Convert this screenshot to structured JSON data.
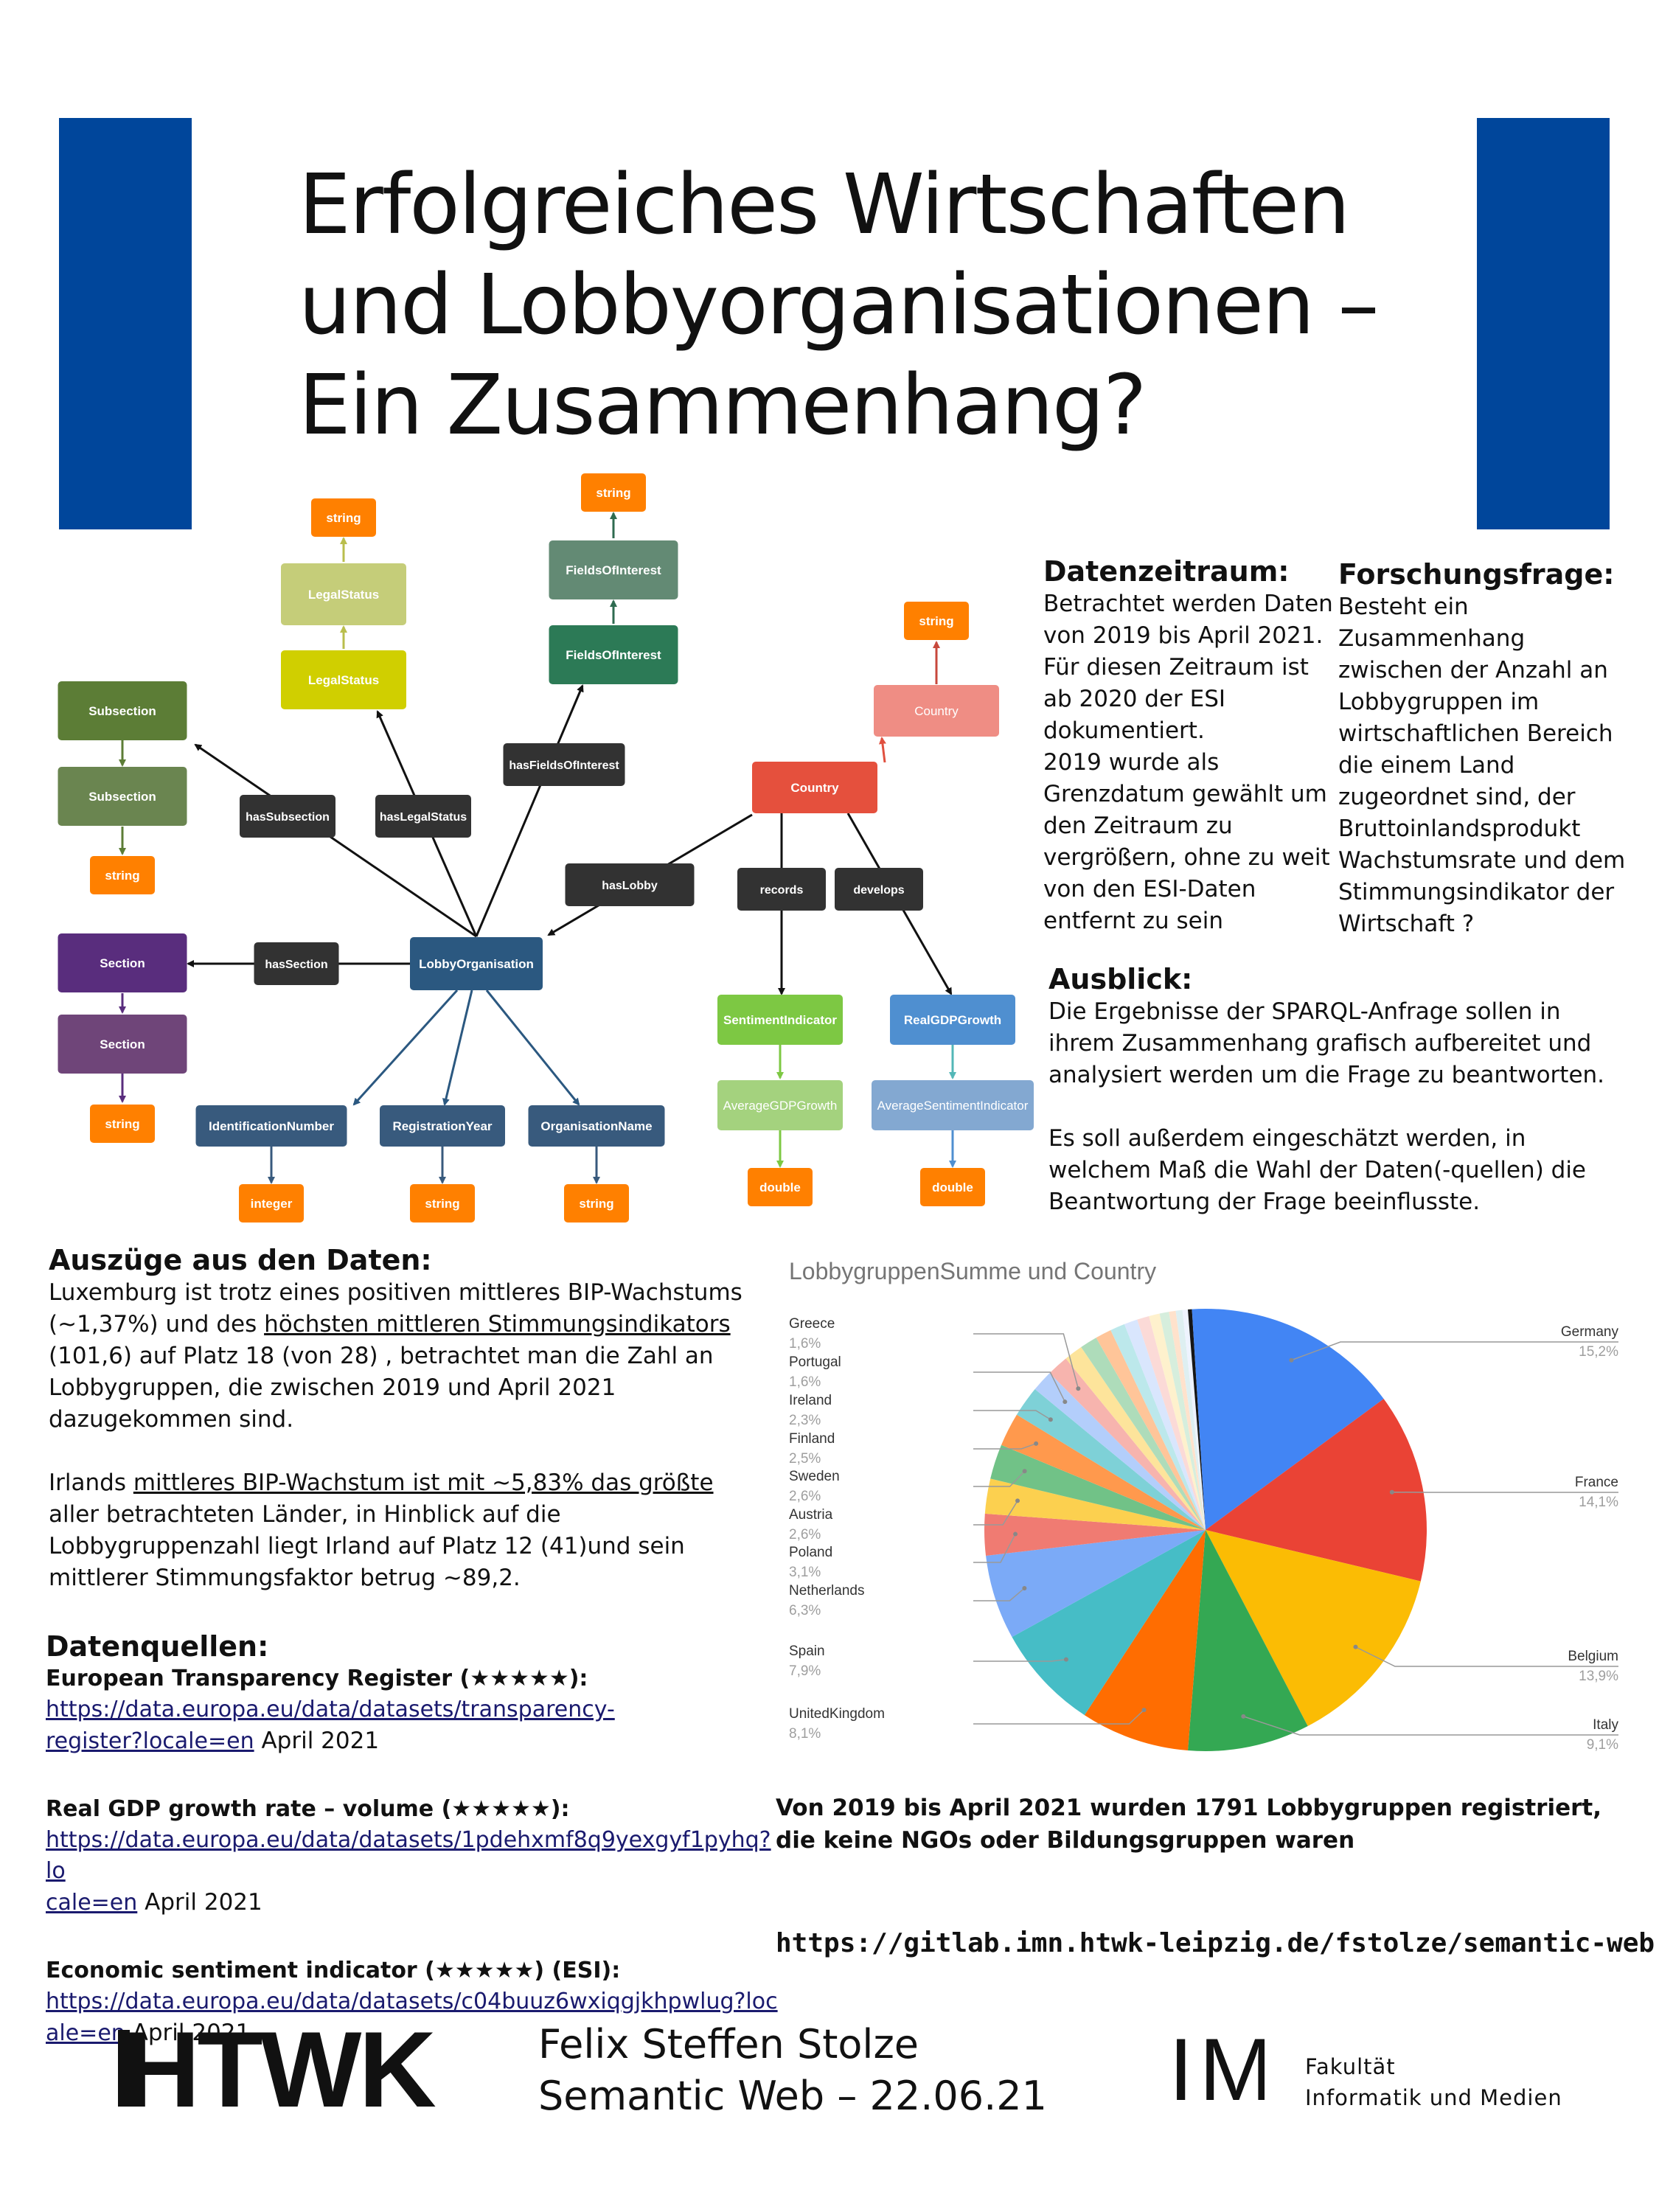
{
  "title": [
    "Erfolgreiches Wirtschaften",
    "und Lobbyorganisationen –",
    "Ein Zusammenhang?"
  ],
  "colors": {
    "hs_blue": "#00469b"
  },
  "diagram": {
    "nodes": {
      "string_legal": "string",
      "legal2": "LegalStatus",
      "legal1": "LegalStatus",
      "string_fields": "string",
      "fields2": "FieldsOfInterest",
      "fields1": "FieldsOfInterest",
      "string_country": "string",
      "country2": "Country",
      "country1": "Country",
      "subsection1": "Subsection",
      "subsection2": "Subsection",
      "string_sub": "string",
      "section1": "Section",
      "section2": "Section",
      "string_sec": "string",
      "lobby": "LobbyOrganisation",
      "idnum": "IdentificationNumber",
      "regyear": "RegistrationYear",
      "orgname": "OrganisationName",
      "integer": "integer",
      "string_reg": "string",
      "string_org": "string",
      "sentiment": "SentimentIndicator",
      "realgdp": "RealGDPGrowth",
      "avggdp": "AverageGDPGrowth",
      "avgsent": "AverageSentimentIndicator",
      "double1": "double",
      "double2": "double"
    },
    "edges": {
      "hasSubsection": "hasSubsection",
      "hasLegalStatus": "hasLegalStatus",
      "hasFieldsOfInterest": "hasFieldsOfInterest",
      "hasLobby": "hasLobby",
      "records": "records",
      "develops": "develops",
      "hasSection": "hasSection"
    }
  },
  "datenzeitraum": {
    "heading": "Datenzeitraum:",
    "lines": [
      "Betrachtet werden Daten",
      "von 2019 bis April 2021.",
      "Für diesen Zeitraum ist",
      "ab 2020 der ESI",
      "dokumentiert.",
      "2019 wurde als",
      "Grenzdatum gewählt um",
      "den Zeitraum zu",
      "vergrößern, ohne zu weit",
      "von den ESI-Daten",
      "entfernt zu sein"
    ]
  },
  "forschungsfrage": {
    "heading": "Forschungsfrage:",
    "lines": [
      "Besteht ein",
      "Zusammenhang",
      "zwischen der Anzahl an",
      "Lobbygruppen im",
      "wirtschaftlichen Bereich",
      "die einem Land",
      "zugeordnet sind, der",
      "Bruttoinlandsprodukt",
      "Wachstumsrate und dem",
      "Stimmungsindikator der",
      "Wirtschaft ?"
    ]
  },
  "ausblick": {
    "heading": "Ausblick:",
    "lines1": [
      "Die Ergebnisse der SPARQL-Anfrage sollen in",
      "ihrem Zusammenhang grafisch aufbereitet und",
      "analysiert werden um die Frage zu beantworten."
    ],
    "lines2": [
      "Es soll außerdem eingeschätzt werden, in",
      "welchem Maß die Wahl der Daten(-quellen) die",
      "Beantwortung der Frage beeinflusste."
    ]
  },
  "auszuege": {
    "heading": "Auszüge aus den Daten:",
    "p1": {
      "l1": "Luxemburg ist trotz eines positiven mittleres BIP-Wachstums",
      "l2a": "(~1,37%) und des ",
      "l2u": "höchsten mittleren Stimmungsindikators",
      "l3": "(101,6) auf Platz 18 (von 28) , betrachtet man die Zahl an",
      "l4": "Lobbygruppen, die zwischen 2019 und April 2021",
      "l5": "dazugekommen sind."
    },
    "p2": {
      "l1a": "Irlands ",
      "l1u": "mittleres BIP-Wachstum ist mit ~5,83% das größte",
      "l2": "aller betrachteten Länder, in Hinblick auf die",
      "l3": "Lobbygruppenzahl liegt Irland auf Platz 12 (41)und sein",
      "l4": "mittlerer Stimmungsfaktor betrug ~89,2."
    }
  },
  "datenquellen": {
    "heading": "Datenquellen:",
    "sources": [
      {
        "name": "European Transparency Register (★★★★★):",
        "link1": "https://data.europa.eu/data/datasets/transparency-",
        "link2": "register?locale=en",
        "date": " April 2021"
      },
      {
        "name": "Real GDP growth rate – volume (★★★★★):",
        "link1": "https://data.europa.eu/data/datasets/1pdehxmf8q9yexgyf1pyhq?lo",
        "link2": "cale=en",
        "date": " April 2021"
      },
      {
        "name": "Economic sentiment indicator (★★★★★)  (ESI):",
        "link1": "https://data.europa.eu/data/datasets/c04buuz6wxiqgjkhpwlug?loc",
        "link2": "ale=en",
        "date": " April 2021"
      }
    ]
  },
  "chart_data": {
    "type": "pie",
    "title": "LobbygruppenSumme und Country",
    "labelled_slices": [
      {
        "name": "Germany",
        "value": 15.2,
        "label": "15,2%"
      },
      {
        "name": "France",
        "value": 14.1,
        "label": "14,1%"
      },
      {
        "name": "Belgium",
        "value": 13.9,
        "label": "13,9%"
      },
      {
        "name": "Italy",
        "value": 9.1,
        "label": "9,1%"
      },
      {
        "name": "UnitedKingdom",
        "value": 8.1,
        "label": "8,1%"
      },
      {
        "name": "Spain",
        "value": 7.9,
        "label": "7,9%"
      },
      {
        "name": "Netherlands",
        "value": 6.3,
        "label": "6,3%"
      },
      {
        "name": "Poland",
        "value": 3.1,
        "label": "3,1%"
      },
      {
        "name": "Austria",
        "value": 2.6,
        "label": "2,6%"
      },
      {
        "name": "Sweden",
        "value": 2.6,
        "label": "2,6%"
      },
      {
        "name": "Finland",
        "value": 2.5,
        "label": "2,5%"
      },
      {
        "name": "Ireland",
        "value": 2.3,
        "label": "2,3%"
      },
      {
        "name": "Portugal",
        "value": 1.6,
        "label": "1,6%"
      },
      {
        "name": "Greece",
        "value": 1.6,
        "label": "1,6%"
      }
    ],
    "unlabelled_slices": [
      1.4,
      1.3,
      1.2,
      1.1,
      1.0,
      0.9,
      0.8,
      0.7,
      0.5,
      0.5,
      0.4,
      0.3,
      1.0
    ],
    "colors": [
      "#4285f4",
      "#ea4335",
      "#fbbc04",
      "#34a853",
      "#ff6d01",
      "#46bdc6",
      "#7baaf7",
      "#f07b72",
      "#fcd04f",
      "#71c287",
      "#ff994d",
      "#7ed1d7",
      "#b3cefb",
      "#f7b4ae",
      "#fde49b",
      "#aedcba",
      "#ffc599",
      "#bce8eb",
      "#d9e6fd",
      "#fbdad7",
      "#fef1cd",
      "#d6eedd",
      "#ffe2cc",
      "#deeff1",
      "#eef3fe",
      "#161616"
    ]
  },
  "summary": "Von 2019 bis April 2021 wurden 1791 Lobbygruppen registriert, die keine NGOs oder Bildungsgruppen waren",
  "repo_url": "https://gitlab.imn.htwk-leipzig.de/fstolze/semantic-web",
  "footer": {
    "logo": "HTWK",
    "author": "Felix Steffen Stolze",
    "course": "Semantic Web – 22.06.21",
    "im_logo": "IM",
    "faculty1": "Fakultät",
    "faculty2": "Informatik und Medien"
  }
}
